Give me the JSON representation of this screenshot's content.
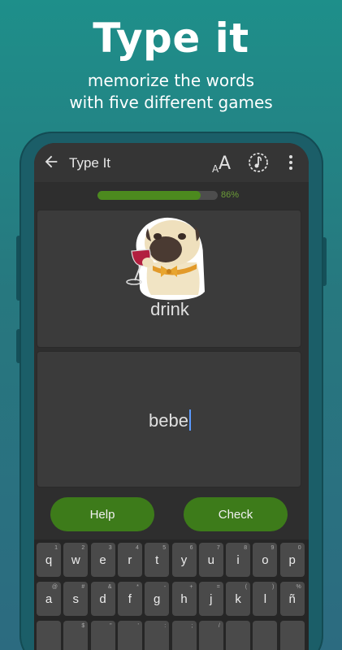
{
  "promo": {
    "title": "Type it",
    "subtitle_line1": "memorize the words",
    "subtitle_line2": "with five different games"
  },
  "appbar": {
    "title": "Type It",
    "icons": [
      "back-arrow-icon",
      "font-size-icon",
      "timer-icon",
      "more-vert-icon"
    ]
  },
  "progress": {
    "value": 0.86,
    "label": "86%"
  },
  "word_card": {
    "sticker": "pug-drinking-wine-sticker",
    "word": "drink"
  },
  "answer": {
    "value": "bebe"
  },
  "buttons": {
    "help": "Help",
    "check": "Check"
  },
  "keyboard": {
    "row1": [
      {
        "key": "q",
        "hint": "1"
      },
      {
        "key": "w",
        "hint": "2"
      },
      {
        "key": "e",
        "hint": "3"
      },
      {
        "key": "r",
        "hint": "4"
      },
      {
        "key": "t",
        "hint": "5"
      },
      {
        "key": "y",
        "hint": "6"
      },
      {
        "key": "u",
        "hint": "7"
      },
      {
        "key": "i",
        "hint": "8"
      },
      {
        "key": "o",
        "hint": "9"
      },
      {
        "key": "p",
        "hint": "0"
      }
    ],
    "row2": [
      {
        "key": "a",
        "hint": "@"
      },
      {
        "key": "s",
        "hint": "#"
      },
      {
        "key": "d",
        "hint": "&"
      },
      {
        "key": "f",
        "hint": "*"
      },
      {
        "key": "g",
        "hint": "-"
      },
      {
        "key": "h",
        "hint": "+"
      },
      {
        "key": "j",
        "hint": "="
      },
      {
        "key": "k",
        "hint": "("
      },
      {
        "key": "l",
        "hint": ")"
      },
      {
        "key": "ñ",
        "hint": "%"
      }
    ],
    "row3_hints": [
      "",
      "$",
      "\"",
      "'",
      ":",
      ";",
      "/",
      "",
      "",
      ""
    ]
  },
  "colors": {
    "background_top": "#1e8f8a",
    "accent_green": "#3d7b1a",
    "progress_green": "#4c8a1e",
    "surface": "#3b3b3b"
  }
}
